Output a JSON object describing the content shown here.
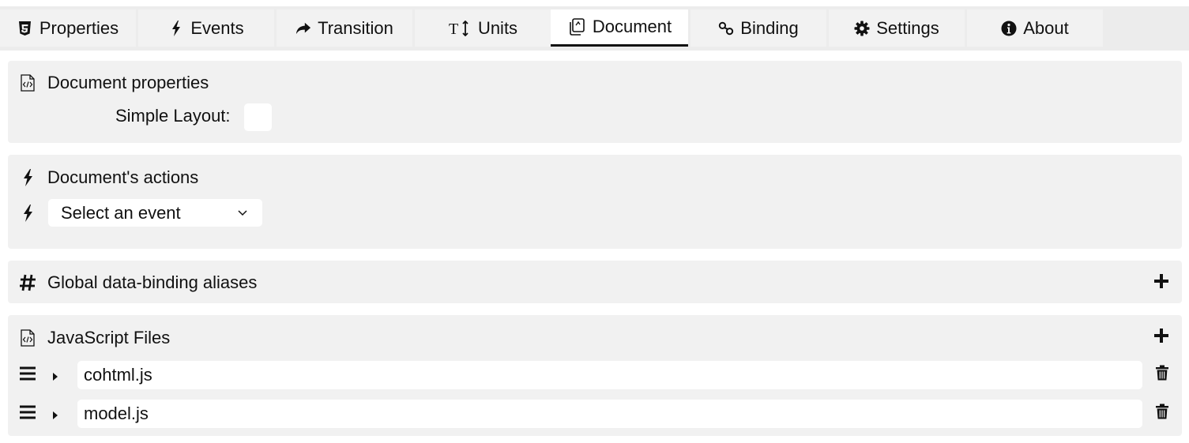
{
  "tabs": [
    {
      "label": "Properties",
      "icon": "html5-icon",
      "active": false
    },
    {
      "label": "Events",
      "icon": "bolt-icon",
      "active": false
    },
    {
      "label": "Transition",
      "icon": "share-arrow-icon",
      "active": false
    },
    {
      "label": "Units",
      "icon": "text-height-icon",
      "active": false
    },
    {
      "label": "Document",
      "icon": "documents-icon",
      "active": true
    },
    {
      "label": "Binding",
      "icon": "link-icon",
      "active": false
    },
    {
      "label": "Settings",
      "icon": "gear-icon",
      "active": false
    },
    {
      "label": "About",
      "icon": "info-circle-icon",
      "active": false
    }
  ],
  "document_properties": {
    "title": "Document properties",
    "simple_layout_label": "Simple Layout:",
    "simple_layout_checked": false
  },
  "document_actions": {
    "title": "Document's actions",
    "event_select_value": "Select an event"
  },
  "aliases": {
    "title": "Global data-binding aliases"
  },
  "javascript_files": {
    "title": "JavaScript Files",
    "files": [
      "cohtml.js",
      "model.js"
    ]
  },
  "colors": {
    "panel_bg": "#f1f1f1",
    "tabbar_bg": "#ececec",
    "active_tab_underline": "#111111"
  }
}
